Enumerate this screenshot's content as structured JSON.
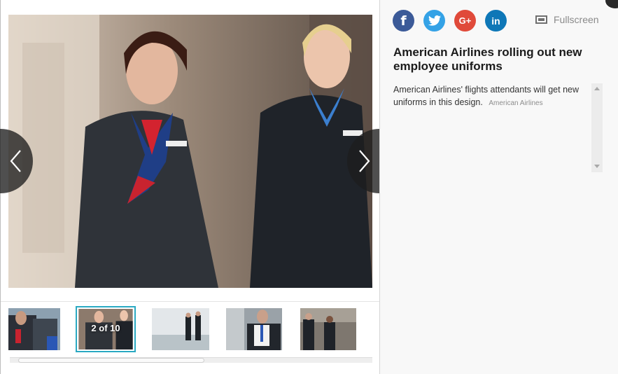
{
  "gallery": {
    "main_image_alt": "American Airlines flight attendants in new uniforms",
    "counter": "2 of 10",
    "thumbnails": [
      {
        "name": "thumb-1"
      },
      {
        "name": "thumb-2"
      },
      {
        "name": "thumb-3"
      },
      {
        "name": "thumb-4"
      },
      {
        "name": "thumb-5"
      }
    ],
    "prev_icon": "chevron-left-icon",
    "next_icon": "chevron-right-icon"
  },
  "panel": {
    "social": {
      "facebook": "f",
      "twitter": "twitter-bird-icon",
      "googleplus": "G+",
      "linkedin": "in"
    },
    "fullscreen_label": "Fullscreen",
    "title": "American Airlines rolling out new employee uniforms",
    "caption": "American Airlines' flights attendants will get new uniforms in this design.",
    "source": "American Airlines"
  },
  "colors": {
    "facebook": "#3b5a98",
    "twitter": "#34a2e6",
    "googleplus": "#e04a3a",
    "linkedin": "#0e77b7",
    "active_thumb_border": "#2aa9c2",
    "accent": "#1c9b96"
  }
}
